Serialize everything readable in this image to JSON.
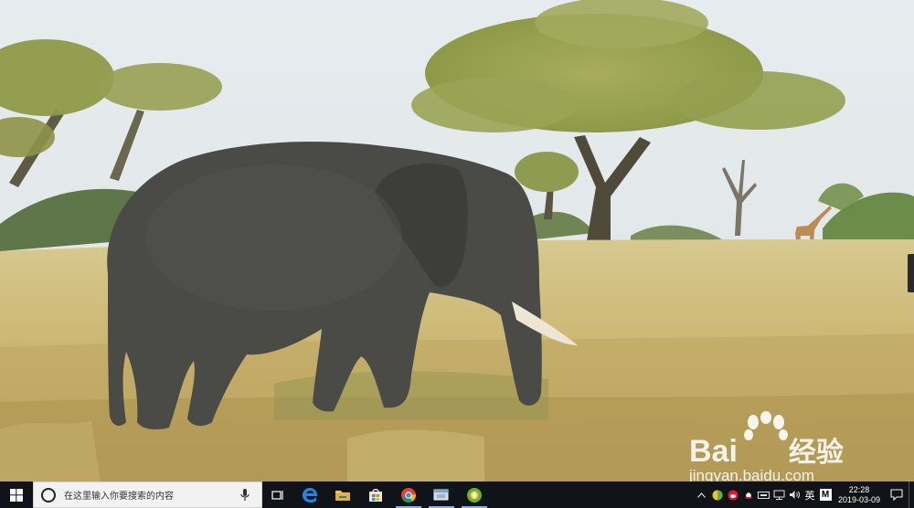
{
  "desktop": {
    "wallpaper": "elephant-savanna",
    "watermark": {
      "brand_prefix": "Bai",
      "brand_suffix": "经验",
      "url": "jingyan.baidu.com"
    }
  },
  "taskbar": {
    "start_icon": "windows-logo-icon",
    "search": {
      "placeholder": "在这里输入你要搜索的内容"
    },
    "apps": [
      {
        "name": "edge",
        "icon": "edge-icon",
        "active": false
      },
      {
        "name": "file-explorer",
        "icon": "folder-icon",
        "active": false
      },
      {
        "name": "store",
        "icon": "store-icon",
        "active": false
      },
      {
        "name": "chrome",
        "icon": "chrome-icon",
        "active": true
      },
      {
        "name": "app5",
        "icon": "app-window-icon",
        "active": true
      },
      {
        "name": "app6",
        "icon": "green-circle-app-icon",
        "active": true
      }
    ],
    "tray": {
      "ime_label": "英",
      "m_label": "M",
      "time": "22:28",
      "date": "2019-03-09"
    },
    "colors": {
      "taskbar_bg": "#101418",
      "accent": "#7fb3ea"
    }
  }
}
